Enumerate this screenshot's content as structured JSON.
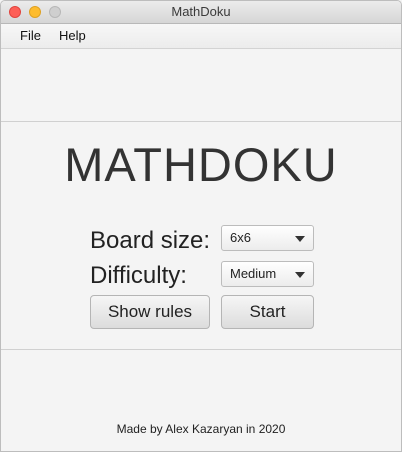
{
  "window": {
    "title": "MathDoku"
  },
  "menubar": {
    "items": [
      {
        "label": "File"
      },
      {
        "label": "Help"
      }
    ]
  },
  "main": {
    "app_title": "MATHDOKU",
    "board_size": {
      "label": "Board size:",
      "selected": "6x6"
    },
    "difficulty": {
      "label": "Difficulty:",
      "selected": "Medium"
    },
    "buttons": {
      "show_rules": "Show rules",
      "start": "Start"
    }
  },
  "footer": {
    "text": "Made by Alex Kazaryan in 2020"
  },
  "colors": {
    "close": "#fd5f57",
    "minimize": "#fdbc2e",
    "maximize_disabled": "#cfcfcf"
  },
  "icons": [
    "close-icon",
    "minimize-icon",
    "maximize-icon",
    "dropdown-caret-icon"
  ]
}
